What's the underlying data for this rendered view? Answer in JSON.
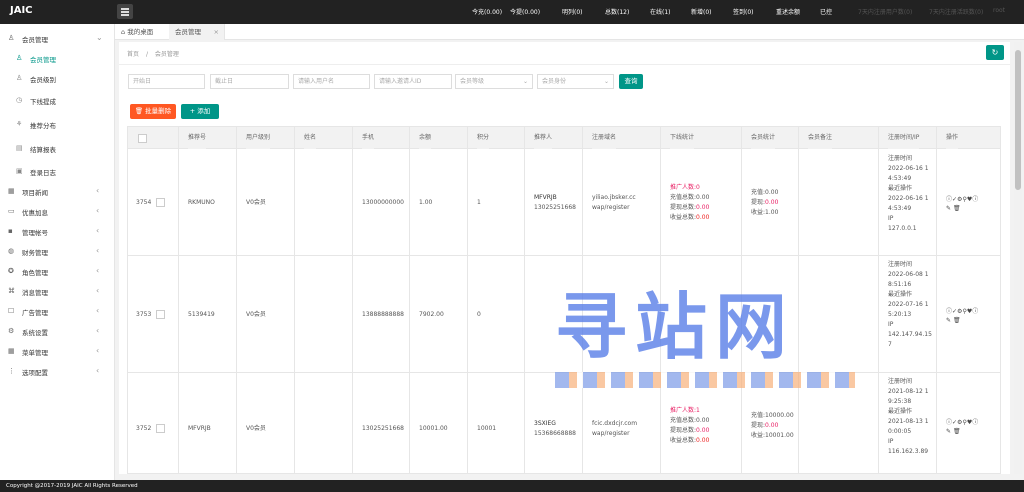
{
  "app": {
    "logo": "JAIC"
  },
  "topbar": {
    "stats": [
      "今充(0.00)",
      "今提(0.00)",
      "明列(0)",
      "总数(12)",
      "在线(1)",
      "新增(0)",
      "签到(0)",
      "重述余额",
      "已控",
      "7天内注册用户数(0)",
      "7天内注册活跃数(0)",
      "root"
    ]
  },
  "sidebar": {
    "member_group": "会员管理",
    "sub_items": [
      "会员管理",
      "会员级别",
      "下线提成",
      "推荐分布",
      "结算报表",
      "登录日志"
    ],
    "items": [
      "项目新闻",
      "优惠加息",
      "管理帐号",
      "财务管理",
      "角色管理",
      "消息管理",
      "广告管理",
      "系统设置",
      "菜单管理",
      "选项配置"
    ]
  },
  "tabs": {
    "home": "我的桌面",
    "current": "会员管理"
  },
  "breadcrumb": {
    "home": "首页",
    "sep": "/",
    "current": "会员管理"
  },
  "filters": {
    "start_date": "开始日",
    "end_date": "截止日",
    "username": "请输入用户名",
    "invite_id": "请输入邀请人ID",
    "level": "会员等级",
    "identity": "会员身份",
    "search": "查询"
  },
  "actions": {
    "batch_delete": "批量删除",
    "add": "添加"
  },
  "table": {
    "headers": [
      "推荐号",
      "用户级别",
      "姓名",
      "手机",
      "余额",
      "积分",
      "推荐人",
      "注册域名",
      "下线统计",
      "会员统计",
      "会员备注",
      "注册时间/IP",
      "操作"
    ],
    "rows": [
      {
        "id": "3754",
        "code": "RKMUNO",
        "level": "V0会员",
        "name": "",
        "phone": "13000000000",
        "balance": "1.00",
        "points": "1",
        "referrer": "MFVRJB",
        "referrer_phone": "13025251668",
        "domain": "yiliao.jbsker.cc",
        "domain_path": "wap/register",
        "down_count": "推广人数:0",
        "down_recharge": "充值总数:0.00",
        "down_withdraw_label": "提现总数:",
        "down_withdraw": "0.00",
        "down_income_label": "收益总数:",
        "down_income": "0.00",
        "m_recharge": "充值:0.00",
        "m_withdraw_label": "提现:",
        "m_withdraw": "0.00",
        "m_income": "收益:1.00",
        "reg": [
          "注册时间",
          "2022-06-16 1",
          "4:53:49",
          "最近操作",
          "2022-06-16 1",
          "4:53:49",
          "IP",
          "127.0.0.1"
        ]
      },
      {
        "id": "3753",
        "code": "5139419",
        "level": "V0会员",
        "name": "",
        "phone": "13888888888",
        "balance": "7902.00",
        "points": "0",
        "referrer": "",
        "referrer_phone": "",
        "domain": "",
        "domain_path": "",
        "down_count": "",
        "down_recharge": "",
        "down_withdraw_label": "",
        "down_withdraw": "",
        "down_income_label": "",
        "down_income": "",
        "m_recharge": "",
        "m_withdraw_label": "",
        "m_withdraw": "",
        "m_income": "",
        "reg": [
          "注册时间",
          "2022-06-08 1",
          "8:51:16",
          "最近操作",
          "2022-07-16 1",
          "5:20:13",
          "IP",
          "142.147.94.15",
          "7"
        ]
      },
      {
        "id": "3752",
        "code": "MFVRJB",
        "level": "V0会员",
        "name": "",
        "phone": "13025251668",
        "balance": "10001.00",
        "points": "10001",
        "referrer": "3SXIEG",
        "referrer_phone": "15368668888",
        "domain": "fcic.dxdcjr.com",
        "domain_path": "wap/register",
        "down_count": "推广人数:1",
        "down_recharge": "充值总数:0.00",
        "down_withdraw_label": "提现总数:",
        "down_withdraw": "0.00",
        "down_income_label": "收益总数:",
        "down_income": "0.00",
        "m_recharge": "充值:10000.00",
        "m_withdraw_label": "提现:",
        "m_withdraw": "0.00",
        "m_income": "收益:10001.00",
        "reg": [
          "注册时间",
          "2021-08-12 1",
          "9:25:38",
          "最近操作",
          "2021-08-13 1",
          "0:00:05",
          "IP",
          "116.162.3.89"
        ]
      }
    ]
  },
  "footer": {
    "copyright": "Copyright @2017-2019 JAIC All Rights Reserved"
  },
  "watermark": {
    "text": "寻站网"
  },
  "colors": {
    "accent": "#009688",
    "danger": "#ff5722",
    "topbar": "#222222",
    "pink": "#e91e63"
  }
}
